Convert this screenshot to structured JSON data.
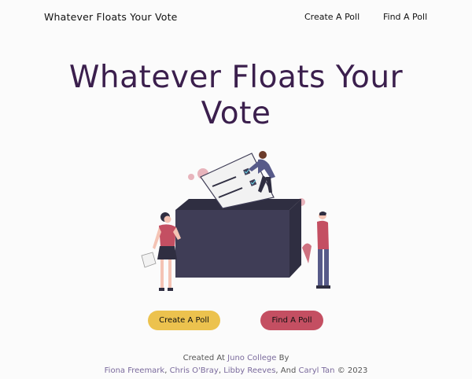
{
  "nav": {
    "brand": "Whatever Floats Your Vote",
    "create_link": "Create A Poll",
    "find_link": "Find A Poll"
  },
  "hero": {
    "title_line1": "Whatever Floats Your",
    "title_line2": "Vote"
  },
  "actions": {
    "create_label": "Create A Poll",
    "find_label": "Find A Poll"
  },
  "footer": {
    "created_at": "Created At",
    "school": "Juno College",
    "by": "By",
    "authors": [
      "Fiona Freemark",
      "Chris O'Bray",
      "Libby Reeves",
      "Caryl Tan"
    ],
    "and": "And",
    "copyright": "© 2023"
  },
  "colors": {
    "title": "#3b1f4d",
    "create_button": "#ecc24e",
    "find_button": "#c44f62",
    "ballot_box": "#3f3d56"
  }
}
